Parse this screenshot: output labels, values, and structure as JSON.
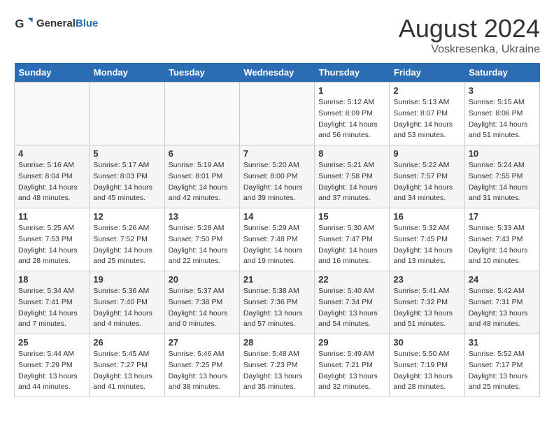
{
  "header": {
    "logo_general": "General",
    "logo_blue": "Blue",
    "month_year": "August 2024",
    "location": "Voskresenka, Ukraine"
  },
  "days_of_week": [
    "Sunday",
    "Monday",
    "Tuesday",
    "Wednesday",
    "Thursday",
    "Friday",
    "Saturday"
  ],
  "weeks": [
    [
      {
        "day": "",
        "info": ""
      },
      {
        "day": "",
        "info": ""
      },
      {
        "day": "",
        "info": ""
      },
      {
        "day": "",
        "info": ""
      },
      {
        "day": "1",
        "info": "Sunrise: 5:12 AM\nSunset: 8:09 PM\nDaylight: 14 hours\nand 56 minutes."
      },
      {
        "day": "2",
        "info": "Sunrise: 5:13 AM\nSunset: 8:07 PM\nDaylight: 14 hours\nand 53 minutes."
      },
      {
        "day": "3",
        "info": "Sunrise: 5:15 AM\nSunset: 8:06 PM\nDaylight: 14 hours\nand 51 minutes."
      }
    ],
    [
      {
        "day": "4",
        "info": "Sunrise: 5:16 AM\nSunset: 8:04 PM\nDaylight: 14 hours\nand 48 minutes."
      },
      {
        "day": "5",
        "info": "Sunrise: 5:17 AM\nSunset: 8:03 PM\nDaylight: 14 hours\nand 45 minutes."
      },
      {
        "day": "6",
        "info": "Sunrise: 5:19 AM\nSunset: 8:01 PM\nDaylight: 14 hours\nand 42 minutes."
      },
      {
        "day": "7",
        "info": "Sunrise: 5:20 AM\nSunset: 8:00 PM\nDaylight: 14 hours\nand 39 minutes."
      },
      {
        "day": "8",
        "info": "Sunrise: 5:21 AM\nSunset: 7:58 PM\nDaylight: 14 hours\nand 37 minutes."
      },
      {
        "day": "9",
        "info": "Sunrise: 5:22 AM\nSunset: 7:57 PM\nDaylight: 14 hours\nand 34 minutes."
      },
      {
        "day": "10",
        "info": "Sunrise: 5:24 AM\nSunset: 7:55 PM\nDaylight: 14 hours\nand 31 minutes."
      }
    ],
    [
      {
        "day": "11",
        "info": "Sunrise: 5:25 AM\nSunset: 7:53 PM\nDaylight: 14 hours\nand 28 minutes."
      },
      {
        "day": "12",
        "info": "Sunrise: 5:26 AM\nSunset: 7:52 PM\nDaylight: 14 hours\nand 25 minutes."
      },
      {
        "day": "13",
        "info": "Sunrise: 5:28 AM\nSunset: 7:50 PM\nDaylight: 14 hours\nand 22 minutes."
      },
      {
        "day": "14",
        "info": "Sunrise: 5:29 AM\nSunset: 7:48 PM\nDaylight: 14 hours\nand 19 minutes."
      },
      {
        "day": "15",
        "info": "Sunrise: 5:30 AM\nSunset: 7:47 PM\nDaylight: 14 hours\nand 16 minutes."
      },
      {
        "day": "16",
        "info": "Sunrise: 5:32 AM\nSunset: 7:45 PM\nDaylight: 14 hours\nand 13 minutes."
      },
      {
        "day": "17",
        "info": "Sunrise: 5:33 AM\nSunset: 7:43 PM\nDaylight: 14 hours\nand 10 minutes."
      }
    ],
    [
      {
        "day": "18",
        "info": "Sunrise: 5:34 AM\nSunset: 7:41 PM\nDaylight: 14 hours\nand 7 minutes."
      },
      {
        "day": "19",
        "info": "Sunrise: 5:36 AM\nSunset: 7:40 PM\nDaylight: 14 hours\nand 4 minutes."
      },
      {
        "day": "20",
        "info": "Sunrise: 5:37 AM\nSunset: 7:38 PM\nDaylight: 14 hours\nand 0 minutes."
      },
      {
        "day": "21",
        "info": "Sunrise: 5:38 AM\nSunset: 7:36 PM\nDaylight: 13 hours\nand 57 minutes."
      },
      {
        "day": "22",
        "info": "Sunrise: 5:40 AM\nSunset: 7:34 PM\nDaylight: 13 hours\nand 54 minutes."
      },
      {
        "day": "23",
        "info": "Sunrise: 5:41 AM\nSunset: 7:32 PM\nDaylight: 13 hours\nand 51 minutes."
      },
      {
        "day": "24",
        "info": "Sunrise: 5:42 AM\nSunset: 7:31 PM\nDaylight: 13 hours\nand 48 minutes."
      }
    ],
    [
      {
        "day": "25",
        "info": "Sunrise: 5:44 AM\nSunset: 7:29 PM\nDaylight: 13 hours\nand 44 minutes."
      },
      {
        "day": "26",
        "info": "Sunrise: 5:45 AM\nSunset: 7:27 PM\nDaylight: 13 hours\nand 41 minutes."
      },
      {
        "day": "27",
        "info": "Sunrise: 5:46 AM\nSunset: 7:25 PM\nDaylight: 13 hours\nand 38 minutes."
      },
      {
        "day": "28",
        "info": "Sunrise: 5:48 AM\nSunset: 7:23 PM\nDaylight: 13 hours\nand 35 minutes."
      },
      {
        "day": "29",
        "info": "Sunrise: 5:49 AM\nSunset: 7:21 PM\nDaylight: 13 hours\nand 32 minutes."
      },
      {
        "day": "30",
        "info": "Sunrise: 5:50 AM\nSunset: 7:19 PM\nDaylight: 13 hours\nand 28 minutes."
      },
      {
        "day": "31",
        "info": "Sunrise: 5:52 AM\nSunset: 7:17 PM\nDaylight: 13 hours\nand 25 minutes."
      }
    ]
  ]
}
